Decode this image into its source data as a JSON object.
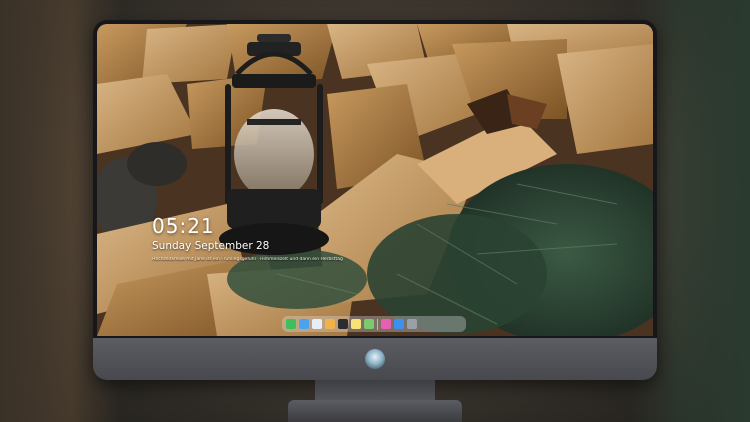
{
  "lockscreen": {
    "time": "05:21",
    "date": "Sunday September  28",
    "quote": "Hochzeitsreise mit Jane ist ein Frühlingsgefühl · Himmelszelt und dann ein Herbsttag"
  },
  "dock": {
    "icons": [
      {
        "name": "messages-icon",
        "color": "#3fbf5a"
      },
      {
        "name": "finder-icon",
        "color": "#4aa3ef"
      },
      {
        "name": "safari-icon",
        "color": "#e8eef5"
      },
      {
        "name": "photos-icon",
        "color": "#f2b24a"
      },
      {
        "name": "clapperboard-icon",
        "color": "#2c2c30"
      },
      {
        "name": "notes-icon",
        "color": "#f7e27a"
      },
      {
        "name": "maps-icon",
        "color": "#7cc96e"
      },
      {
        "name": "itunes-icon",
        "color": "#e65fb0"
      },
      {
        "name": "appstore-icon",
        "color": "#3d8ff0"
      },
      {
        "name": "camera-icon",
        "color": "#9aa0a8"
      }
    ]
  },
  "colors": {
    "bezel": "#17161a",
    "chin": "#4e5055",
    "clock_text": "#ffffff"
  }
}
